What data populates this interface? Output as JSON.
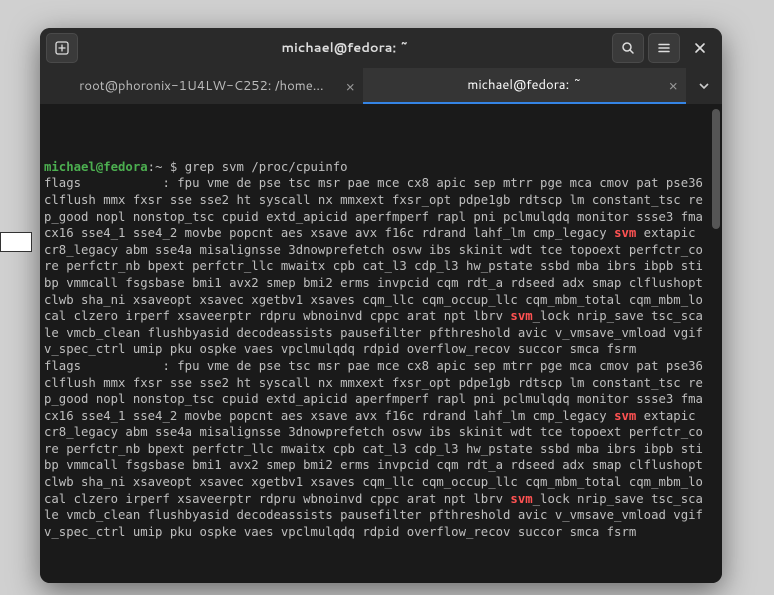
{
  "window": {
    "title": "michael@fedora: ~"
  },
  "tabs": {
    "items": [
      {
        "label": "root@phoronix-1U4LW-C252: /home…",
        "active": false
      },
      {
        "label": "michael@fedora: ~",
        "active": true
      }
    ]
  },
  "terminal": {
    "prompt_user_host": "michael@fedora",
    "prompt_separator": ":",
    "prompt_path": "~",
    "prompt_symbol": "$",
    "command": "grep svm /proc/cpuinfo",
    "match_word": "svm",
    "flags_label": "flags",
    "flags_sep": ":",
    "block1_pre": " fpu vme de pse tsc msr pae mce cx8 apic sep mtrr pge mca cmov pat pse36 clflush mmx fxsr sse sse2 ht syscall nx mmxext fxsr_opt pdpe1gb rdtscp lm constant_tsc rep_good nopl nonstop_tsc cpuid extd_apicid aperfmperf rapl pni pclmulqdq monitor ssse3 fma cx16 sse4_1 sse4_2 movbe popcnt aes xsave avx f16c rdrand lahf_lm cmp_legacy ",
    "block1_mid": " extapic cr8_legacy abm sse4a misalignsse 3dnowprefetch osvw ibs skinit wdt tce topoext perfctr_core perfctr_nb bpext perfctr_llc mwaitx cpb cat_l3 cdp_l3 hw_pstate ssbd mba ibrs ibpb stibp vmmcall fsgsbase bmi1 avx2 smep bmi2 erms invpcid cqm rdt_a rdseed adx smap clflushopt clwb sha_ni xsaveopt xsavec xgetbv1 xsaves cqm_llc cqm_occup_llc cqm_mbm_total cqm_mbm_local clzero irperf xsaveerptr rdpru wbnoinvd cppc arat npt lbrv ",
    "block1_post": "_lock nrip_save tsc_scale vmcb_clean flushbyasid decodeassists pausefilter pfthreshold avic v_vmsave_vmload vgif v_spec_ctrl umip pku ospke vaes vpclmulqdq rdpid overflow_recov succor smca fsrm",
    "block2_pre": " fpu vme de pse tsc msr pae mce cx8 apic sep mtrr pge mca cmov pat pse36 clflush mmx fxsr sse sse2 ht syscall nx mmxext fxsr_opt pdpe1gb rdtscp lm constant_tsc rep_good nopl nonstop_tsc cpuid extd_apicid aperfmperf rapl pni pclmulqdq monitor ssse3 fma cx16 sse4_1 sse4_2 movbe popcnt aes xsave avx f16c rdrand lahf_lm cmp_legacy ",
    "block2_mid": " extapic cr8_legacy abm sse4a misalignsse 3dnowprefetch osvw ibs skinit wdt tce topoext perfctr_core perfctr_nb bpext perfctr_llc mwaitx cpb cat_l3 cdp_l3 hw_pstate ssbd mba ibrs ibpb stibp vmmcall fsgsbase bmi1 avx2 smep bmi2 erms invpcid cqm rdt_a rdseed adx smap clflushopt clwb sha_ni xsaveopt xsavec xgetbv1 xsaves cqm_llc cqm_occup_llc cqm_mbm_total cqm_mbm_local clzero irperf xsaveerptr rdpru wbnoinvd cppc arat npt lbrv ",
    "block2_post": "_lock nrip_save tsc_scale vmcb_clean flushbyasid decodeassists pausefilter pfthreshold avic v_vmsave_vmload vgif v_spec_ctrl umip pku ospke vaes vpclmulqdq rdpid overflow_recov succor smca fsrm"
  }
}
